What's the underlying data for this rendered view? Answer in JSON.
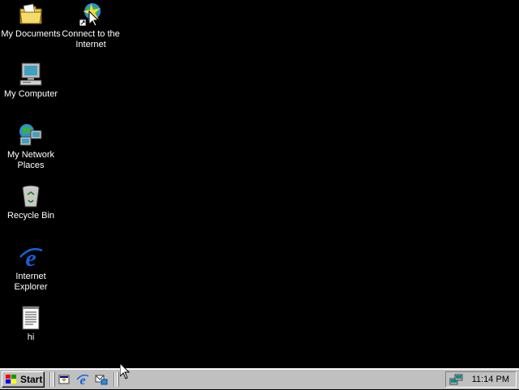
{
  "desktop": {
    "background_color": "#000000",
    "icons": [
      {
        "label": "My Documents",
        "icon": "folder-documents-icon"
      },
      {
        "label": "Connect to the Internet",
        "icon": "connect-internet-icon"
      },
      {
        "label": "My Computer",
        "icon": "computer-icon"
      },
      {
        "label": "My Network Places",
        "icon": "network-icon"
      },
      {
        "label": "Recycle Bin",
        "icon": "recycle-bin-icon"
      },
      {
        "label": "Internet Explorer",
        "icon": "internet-explorer-icon"
      },
      {
        "label": "hi",
        "icon": "text-document-icon"
      }
    ]
  },
  "taskbar": {
    "start_label": "Start",
    "quick_launch": [
      {
        "icon": "show-desktop-icon"
      },
      {
        "icon": "internet-explorer-icon"
      },
      {
        "icon": "outlook-express-icon"
      }
    ],
    "tray": {
      "clock": "11:14 PM",
      "icon": "network-connection-icon"
    }
  }
}
